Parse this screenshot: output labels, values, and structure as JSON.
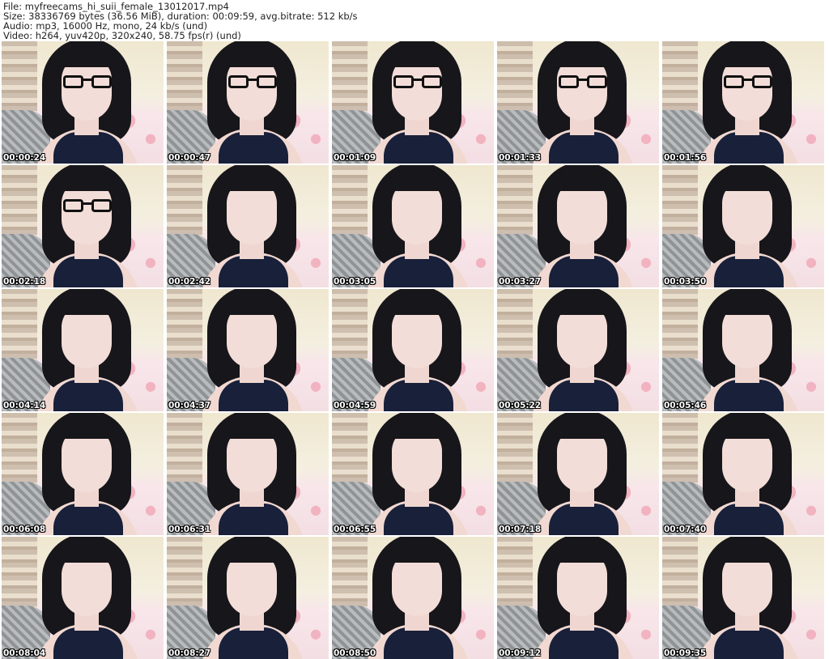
{
  "header": {
    "file": "File: myfreecams_hi_suii_female_13012017.mp4",
    "size": "Size: 38336769 bytes (36.56 MiB), duration: 00:09:59, avg.bitrate: 512 kb/s",
    "audio": "Audio: mp3, 16000 Hz, mono, 24 kb/s (und)",
    "video": "Video: h264, yuv420p, 320x240, 58.75 fps(r) (und)"
  },
  "thumbnails": [
    {
      "time": "00:00:24",
      "glasses": true
    },
    {
      "time": "00:00:47",
      "glasses": true
    },
    {
      "time": "00:01:09",
      "glasses": true
    },
    {
      "time": "00:01:33",
      "glasses": true
    },
    {
      "time": "00:01:56",
      "glasses": true
    },
    {
      "time": "00:02:18",
      "glasses": true
    },
    {
      "time": "00:02:42",
      "glasses": false
    },
    {
      "time": "00:03:05",
      "glasses": false
    },
    {
      "time": "00:03:27",
      "glasses": false
    },
    {
      "time": "00:03:50",
      "glasses": false
    },
    {
      "time": "00:04:14",
      "glasses": false
    },
    {
      "time": "00:04:37",
      "glasses": false
    },
    {
      "time": "00:04:59",
      "glasses": false
    },
    {
      "time": "00:05:22",
      "glasses": false
    },
    {
      "time": "00:05:46",
      "glasses": false
    },
    {
      "time": "00:06:08",
      "glasses": false
    },
    {
      "time": "00:06:31",
      "glasses": false
    },
    {
      "time": "00:06:55",
      "glasses": false
    },
    {
      "time": "00:07:18",
      "glasses": false
    },
    {
      "time": "00:07:40",
      "glasses": false
    },
    {
      "time": "00:08:04",
      "glasses": false
    },
    {
      "time": "00:08:27",
      "glasses": false
    },
    {
      "time": "00:08:50",
      "glasses": false
    },
    {
      "time": "00:09:12",
      "glasses": false
    },
    {
      "time": "00:09:35",
      "glasses": false
    }
  ]
}
